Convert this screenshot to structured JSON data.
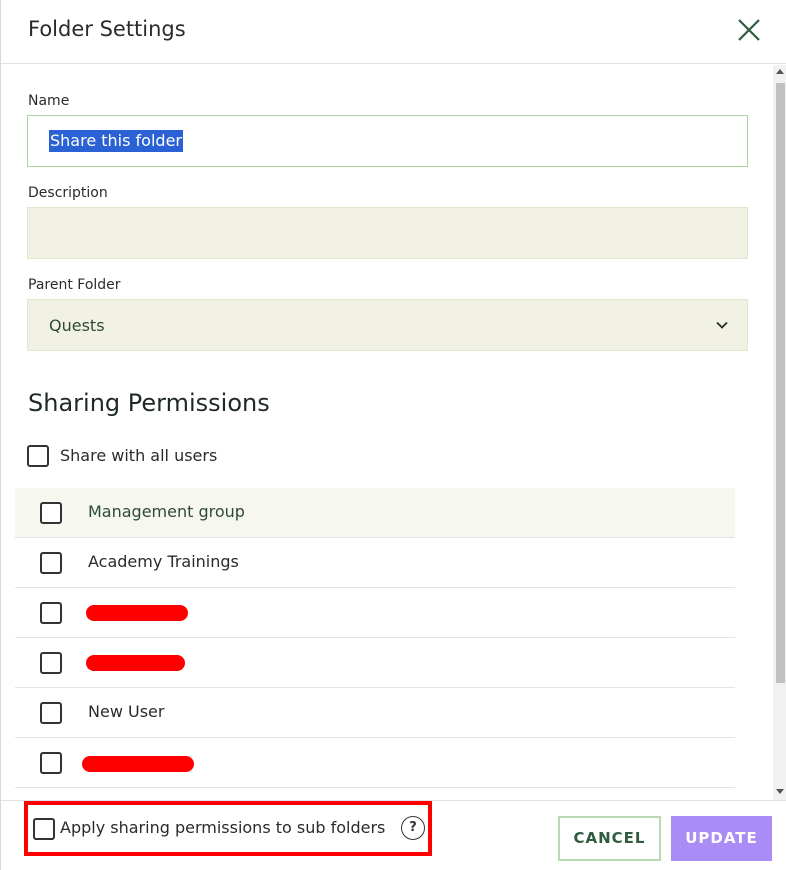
{
  "dialog": {
    "title": "Folder Settings"
  },
  "form": {
    "name_label": "Name",
    "name_value": "Share this folder",
    "description_label": "Description",
    "description_value": "",
    "parent_label": "Parent Folder",
    "parent_value": "Quests"
  },
  "sharing": {
    "title": "Sharing Permissions",
    "share_all_label": "Share with all users",
    "items": [
      {
        "label": "Management group",
        "redacted": false
      },
      {
        "label": "Academy Trainings",
        "redacted": false
      },
      {
        "label": "",
        "redacted": true
      },
      {
        "label": "",
        "redacted": true
      },
      {
        "label": "New User",
        "redacted": false
      },
      {
        "label": "",
        "redacted": true
      }
    ]
  },
  "footer": {
    "apply_label": "Apply sharing permissions to sub folders",
    "help_glyph": "?",
    "cancel_label": "CANCEL",
    "update_label": "UPDATE"
  },
  "colors": {
    "accent": "#a98cf5",
    "highlight": "#ff0000",
    "input_bg": "#f1f2e3"
  }
}
